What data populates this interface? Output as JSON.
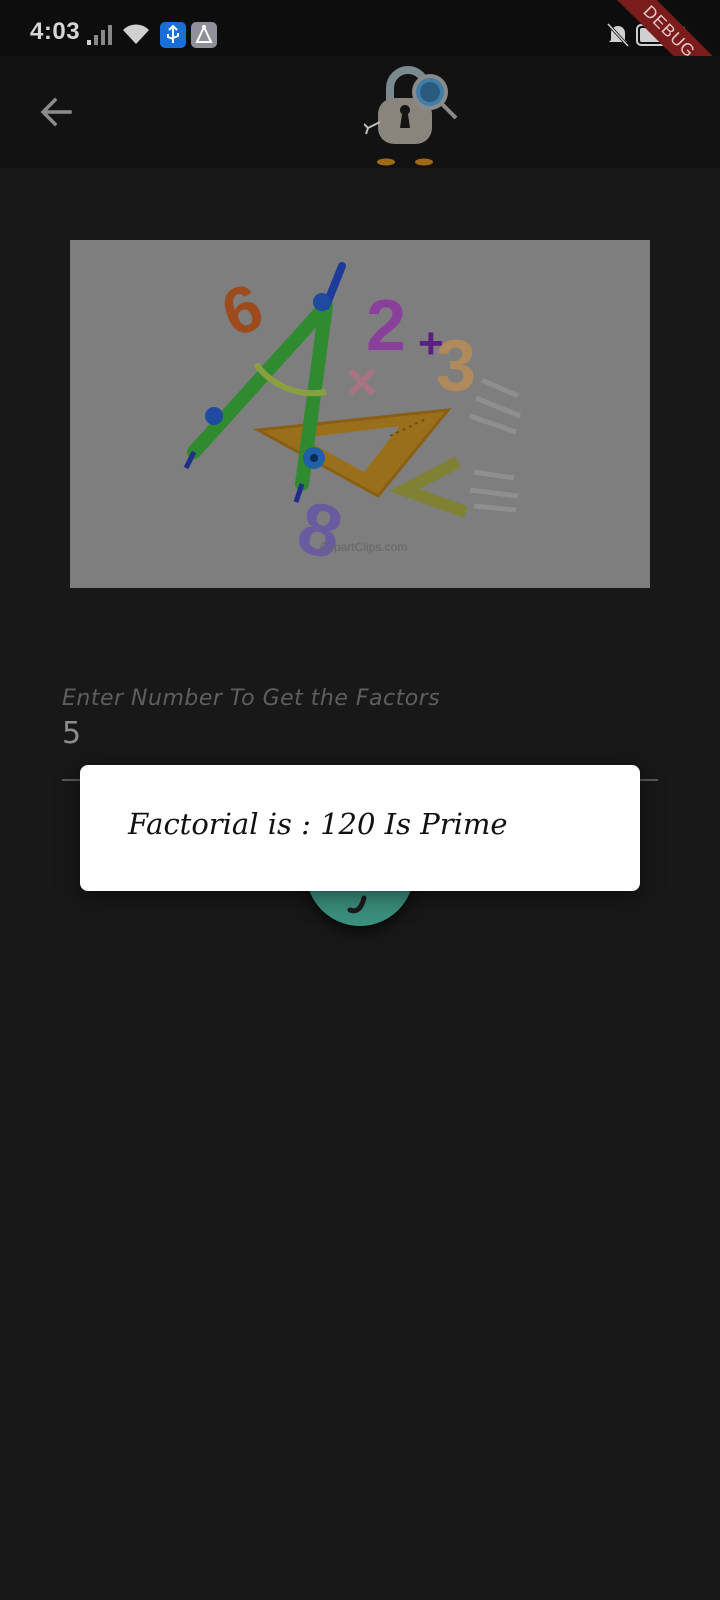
{
  "status_bar": {
    "time": "4:03",
    "debug_label": "DEBUG",
    "icons": [
      "signal-icon",
      "wifi-icon",
      "usb-icon",
      "accessibility-icon",
      "notifications-off-icon",
      "battery-charging-icon"
    ]
  },
  "app_bar": {
    "back_icon": "arrow-back-icon",
    "logo_icon": "padlock-mascot-icon"
  },
  "hero": {
    "image_name": "math-clipart-image",
    "watermark": "ClipartClips.com"
  },
  "input": {
    "label": "Enter Number To Get the Factors",
    "value": "5"
  },
  "dialog": {
    "message": "Factorial is : 120 Is Prime"
  },
  "colors": {
    "background": "#181818",
    "app_bar": "#121212",
    "fab": "#3b8f7d",
    "debug_ribbon": "#7a1c1c",
    "dialog": "#ffffff"
  }
}
